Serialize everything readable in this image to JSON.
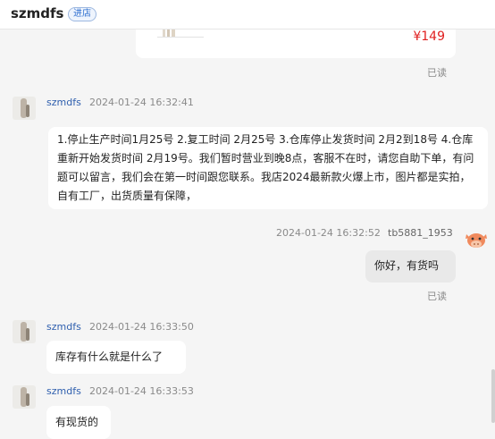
{
  "header": {
    "shop_name": "szmdfs",
    "enter_label": "进店"
  },
  "product_card": {
    "price": "¥149"
  },
  "read_label": "已读",
  "messages": [
    {
      "sender": "szmdfs",
      "time": "2024-01-24 16:32:41",
      "text": "1.停止生产时间1月25号 2.复工时间 2月25号 3.仓库停止发货时间 2月2到18号 4.仓库重新开始发货时间 2月19号。我们暂时营业到晚8点，客服不在时，请您自助下单，有问题可以留言，我们会在第一时间跟您联系。我店2024最新款火爆上市，图片都是实拍，自有工厂，出货质量有保障，"
    },
    {
      "sender": "tb5881_1953",
      "time": "2024-01-24 16:32:52",
      "text": "你好，有货吗"
    },
    {
      "sender": "szmdfs",
      "time": "2024-01-24 16:33:50",
      "text": "库存有什么就是什么了"
    },
    {
      "sender": "szmdfs",
      "time": "2024-01-24 16:33:53",
      "text": "有现货的"
    }
  ],
  "icons": {
    "my_avatar": "cow-avatar-icon",
    "shop_avatar": "product-photo-avatar"
  },
  "colors": {
    "price": "#e02020",
    "sender_name": "#2f5fae",
    "badge": "#2f6fd0",
    "background": "#f5f5f5"
  }
}
